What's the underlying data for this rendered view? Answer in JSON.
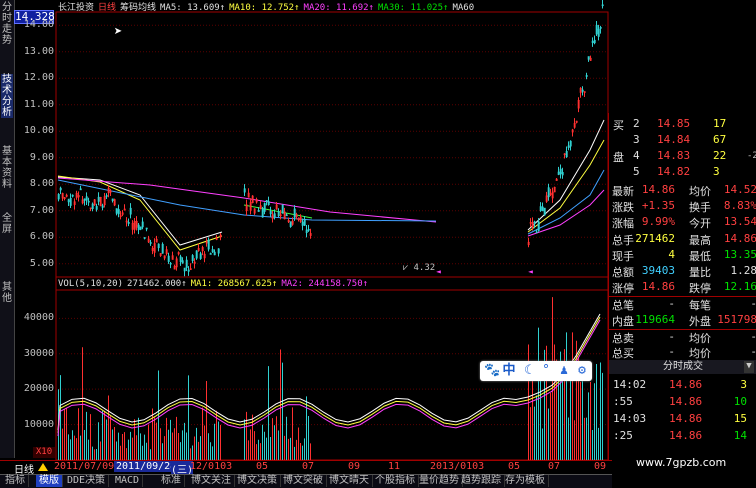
{
  "left_nav": [
    "分时走势",
    "技术分析",
    "基本资料",
    "全屏",
    "其他"
  ],
  "current_price_label": "14.328",
  "header": {
    "stock": "长江投资",
    "period": "日线",
    "indicator": "筹码均线",
    "ma5": "MA5: 13.609↑",
    "ma10": "MA10: 12.752↑",
    "ma20": "MA20: 11.692↑",
    "ma30": "MA30: 11.025↑",
    "ma60": "MA60"
  },
  "price_axis": [
    "14.00",
    "13.00",
    "12.00",
    "11.00",
    "10.00",
    "9.00",
    "8.00",
    "7.00",
    "6.00",
    "5.00"
  ],
  "low_marker": "4.32",
  "vol_header": {
    "label": "VOL(5,10,20)",
    "vol": "271462.000↑",
    "ma1": "MA1: 268567.625↑",
    "ma2": "MA2: 244158.750↑"
  },
  "vol_axis": [
    "40000",
    "30000",
    "20000",
    "10000"
  ],
  "vol_unit": "X10",
  "order_book": [
    {
      "lvl": "2",
      "price": "14.85",
      "vol": "17"
    },
    {
      "lvl": "3",
      "price": "14.84",
      "vol": "67"
    },
    {
      "lvl": "4",
      "price": "14.83",
      "vol": "22"
    },
    {
      "lvl": "5",
      "price": "14.82",
      "vol": "3"
    }
  ],
  "ob_side_top": "买",
  "ob_side_bottom": "盘",
  "ob_extra": "-2",
  "quote_rows": [
    {
      "l1": "最新",
      "v1": "14.86",
      "l2": "均价",
      "v2": "14.52"
    },
    {
      "l1": "涨跌",
      "v1": "+1.35",
      "l2": "换手",
      "v2": "8.83%"
    },
    {
      "l1": "涨幅",
      "v1": "9.99%",
      "l2": "今开",
      "v2": "13.54"
    },
    {
      "l1": "总手",
      "v1": "271462",
      "l2": "最高",
      "v2": "14.86"
    },
    {
      "l1": "现手",
      "v1": "4",
      "l2": "最低",
      "v2": "13.35"
    },
    {
      "l1": "总额",
      "v1": "39403",
      "l2": "量比",
      "v2": "1.28"
    },
    {
      "l1": "涨停",
      "v1": "14.86",
      "l2": "跌停",
      "v2": "12.16"
    },
    {
      "l1": "总笔",
      "v1": "-",
      "l2": "每笔",
      "v2": "-"
    },
    {
      "l1": "内盘",
      "v1": "119664",
      "l2": "外盘",
      "v2": "151798"
    },
    {
      "l1": "总卖",
      "v1": "-",
      "l2": "均价",
      "v2": "-"
    },
    {
      "l1": "总买",
      "v1": "-",
      "l2": "均价",
      "v2": "-"
    }
  ],
  "trades_title": "分时成交",
  "trades": [
    {
      "t": "14:02",
      "p": "14.86",
      "v": "3"
    },
    {
      "t": ":55",
      "p": "14.86",
      "v": "10"
    },
    {
      "t": "14:03",
      "p": "14.86",
      "v": "15"
    },
    {
      "t": ":25",
      "p": "14.86",
      "v": "14"
    }
  ],
  "date_bar": {
    "tab": "日线",
    "d1": "2011/07/09",
    "d2": "2011/09/28",
    "d2b": "(三)",
    "d3": "12/0103",
    "m1": "05",
    "m2": "07",
    "m3": "09",
    "m4": "11",
    "d4": "2013/0103",
    "m5": "05",
    "m6": "07",
    "m7": "09"
  },
  "bottom_tabs": [
    "指标",
    "模版",
    "DDE决策",
    "MACD",
    "标准",
    "博文关注",
    "博文决策",
    "博文突破",
    "博文晴天",
    "个股指标",
    "量价趋势",
    "趋势跟踪",
    "存为模板"
  ],
  "float_bar": [
    "paw-icon",
    "中",
    "moon-icon",
    "dots-icon",
    "person-icon",
    "gear-icon"
  ],
  "watermark": "www.7gpzb.com",
  "chart_data": {
    "type": "candlestick-with-volume",
    "price_ylim": [
      4.5,
      14.5
    ],
    "volume_ylim": [
      0,
      48000
    ],
    "last_close": 14.86,
    "price_low": 4.32
  }
}
